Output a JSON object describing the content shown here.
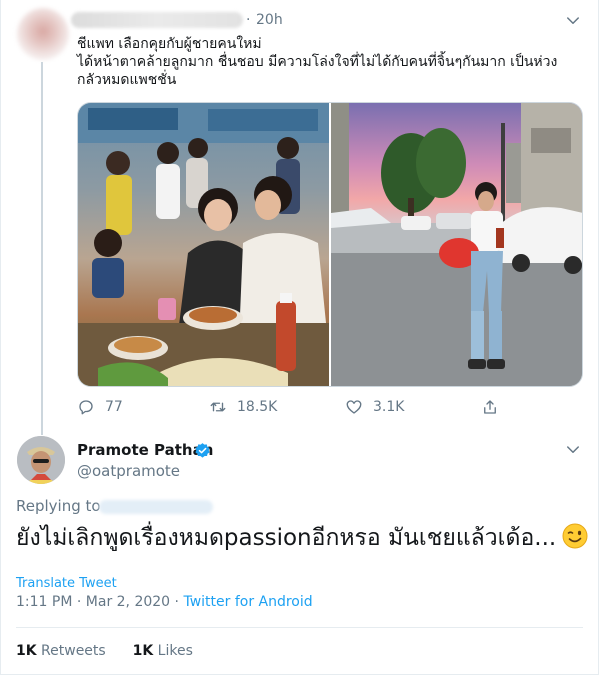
{
  "parent_tweet": {
    "time": "20h",
    "text_lines": [
      "ชีแพท เลือกคุยกับผู้ชายคนใหม่",
      "ได้หน้าตาคล้ายลูกมาก ชื่นชอบ มีความโล่งใจที่ไม่ได้กับคนที่จิ้นๆกันมาก เป็นห่วง",
      "กลัวหมดแพชชั่น"
    ],
    "actions": {
      "replies": "77",
      "retweets": "18.5K",
      "likes": "3.1K"
    }
  },
  "main_tweet": {
    "name": "Pramote Pathan",
    "handle": "@oatpramote",
    "replying_label": "Replying to",
    "text": "ยังไม่เลิกพูดเรื่องหมดpassionอีกหรอ มันเชยแล้วเด้อ...",
    "translate_label": "Translate Tweet",
    "time": "1:11 PM",
    "date": "Mar 2, 2020",
    "separator": "·",
    "source": "Twitter for Android",
    "retweets_count": "1K",
    "retweets_label": "Retweets",
    "likes_count": "1K",
    "likes_label": "Likes"
  },
  "colors": {
    "accent": "#1da1f2",
    "muted": "#657786",
    "text": "#14171a"
  }
}
